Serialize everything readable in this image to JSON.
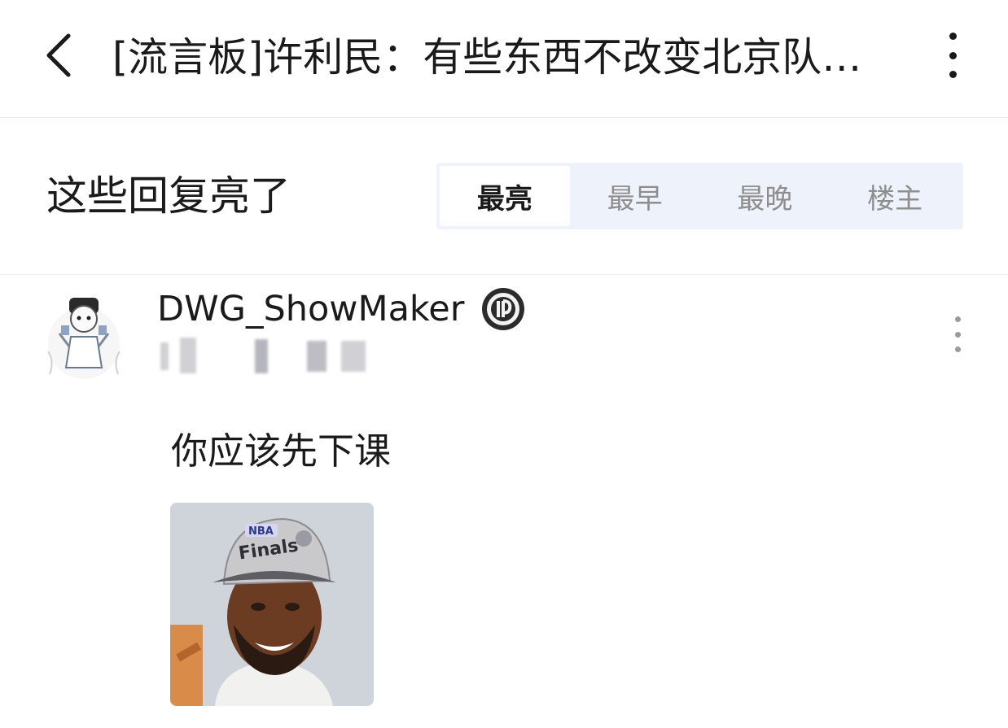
{
  "header": {
    "title": "[流言板]许利民：有些东西不改变北京队很难崛起",
    "back_icon": "chevron-left-icon",
    "more_icon": "vertical-ellipsis-icon"
  },
  "replies_section": {
    "title": "这些回复亮了",
    "sort_tabs": [
      {
        "label": "最亮",
        "active": true
      },
      {
        "label": "最早",
        "active": false
      },
      {
        "label": "最晚",
        "active": false
      },
      {
        "label": "楼主",
        "active": false
      }
    ]
  },
  "reply": {
    "username": "DWG_ShowMaker",
    "badge_icon": "team-logo-badge-icon",
    "text": "你应该先下课",
    "meme_caption": "NBA Finals"
  },
  "colors": {
    "tab_background": "#eef2fa",
    "active_tab_text": "#1a1a1a",
    "inactive_tab_text": "#8e8e8e"
  }
}
